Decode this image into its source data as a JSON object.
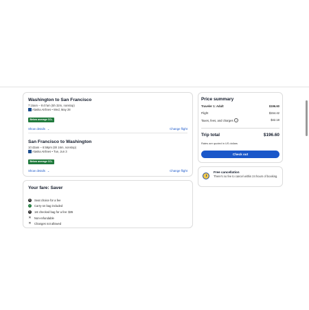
{
  "flights": [
    {
      "route": "Washington to San Francisco",
      "times": "7:15am – 9:47am (5h 32m, nonstop)",
      "airline": "Alaska Airlines • Wed, May 28",
      "co2_badge": "Below average CO₂",
      "show_details": "Show details",
      "change_flight": "Change flight"
    },
    {
      "route": "San Francisco to Washington",
      "times": "10:43am – 6:59pm (5h 16m, nonstop)",
      "airline": "Alaska Airlines • Tue, Jun 3",
      "co2_badge": "Below average CO₂",
      "show_details": "Show details",
      "change_flight": "Change flight"
    }
  ],
  "fare": {
    "title": "Your fare: Saver",
    "items": [
      {
        "icon": "dollar-icon",
        "text": "Seat choice for a fee"
      },
      {
        "icon": "check-icon",
        "text": "Carry-on bag included"
      },
      {
        "icon": "dollar-icon",
        "text": "1st checked bag for a fee: $35"
      },
      {
        "icon": "x-icon",
        "text": "Non-refundable"
      },
      {
        "icon": "x-icon",
        "text": "Changes not allowed"
      }
    ]
  },
  "price_summary": {
    "title": "Price summary",
    "traveler_label": "Traveler 1: Adult",
    "traveler_value": "$196.60",
    "flight_label": "Flight",
    "flight_value": "$154.42",
    "taxes_label": "Taxes, fees, and charges",
    "taxes_value": "$42.18",
    "total_label": "Trip total",
    "total_value": "$196.60",
    "note": "Rates are quoted in US dollars",
    "checkout_label": "Check out"
  },
  "cancellation": {
    "title": "Free cancellation",
    "text": "There's no fee to cancel within 24 hours of booking."
  },
  "colors": {
    "accent": "#1a57c9",
    "co2_badge": "#1f7a3c"
  }
}
